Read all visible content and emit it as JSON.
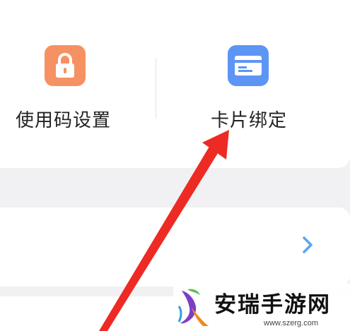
{
  "tiles": [
    {
      "label": "使用码设置",
      "icon": "lock-icon"
    },
    {
      "label": "卡片绑定",
      "icon": "card-icon"
    }
  ],
  "list_row": {
    "icon": "chevron-right-icon"
  },
  "watermark": {
    "title": "安瑞手游网",
    "url": "www.szerg.com"
  },
  "colors": {
    "lock_tile": "#f69164",
    "card_tile": "#5d95f5",
    "arrow": "#ee2a24",
    "chevron": "#5aa3f3",
    "background": "#f1f1f3"
  }
}
